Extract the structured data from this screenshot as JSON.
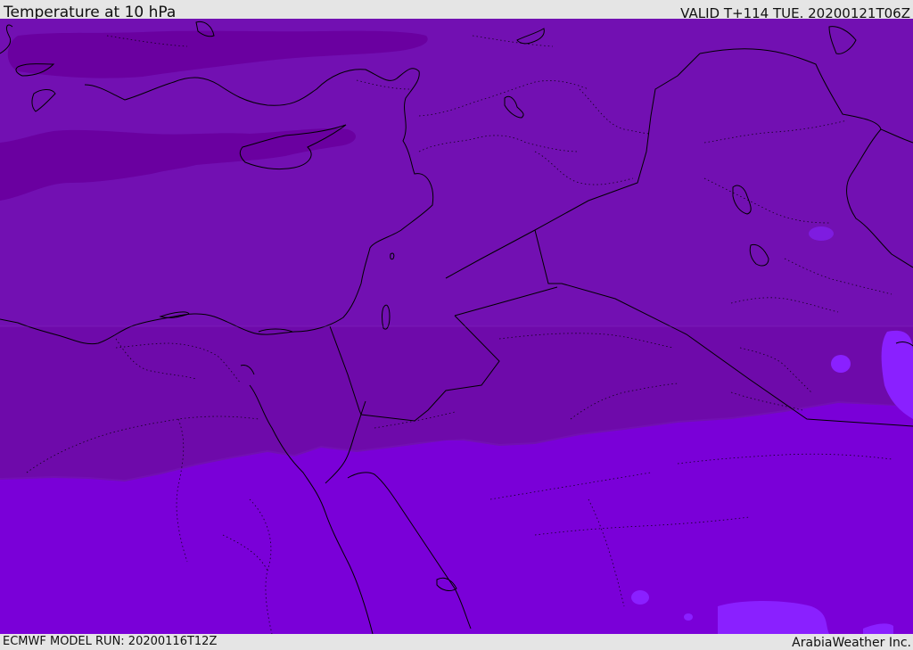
{
  "header": {
    "title": "Temperature at 10 hPa",
    "valid_time": "VALID T+114 TUE. 20200121T06Z"
  },
  "footer": {
    "model_run": "ECMWF MODEL RUN: 20200116T12Z",
    "credit": "ArabiaWeather Inc."
  },
  "map": {
    "fill_colors": {
      "coldest": "#6a00a0",
      "cold": "#7210b2",
      "cool": "#6e0aaa",
      "mild": "#7a00d8",
      "warm": "#8a20ff"
    },
    "coastline_color": "#000000"
  }
}
